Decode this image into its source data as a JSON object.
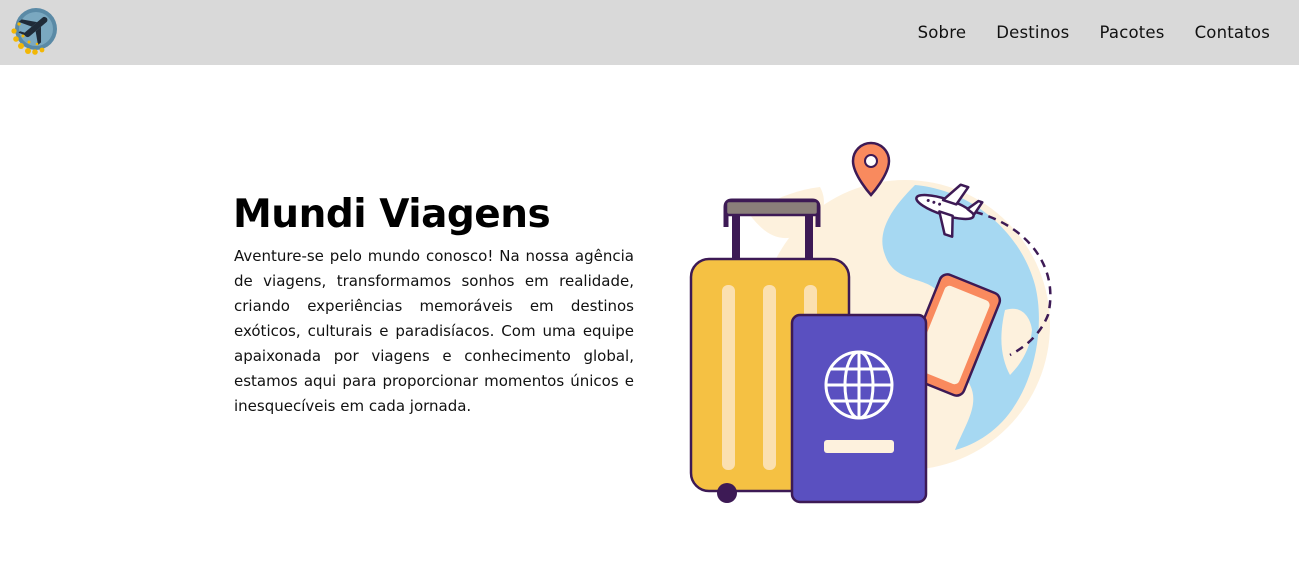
{
  "header": {
    "logo_icon": "airplane-logo-icon",
    "nav": [
      {
        "label": "Sobre"
      },
      {
        "label": "Destinos"
      },
      {
        "label": "Pacotes"
      },
      {
        "label": "Contatos"
      }
    ]
  },
  "hero": {
    "title": "Mundi Viagens",
    "description": "Aventure-se pelo mundo conosco! Na nossa agência de viagens, transformamos sonhos em realidade, criando experiências memoráveis em destinos exóticos, culturais e paradisíacos. Com uma equipe apaixonada por viagens e conhecimento global, estamos aqui para proporcionar momentos únicos e inesquecíveis em cada jornada.",
    "illustration": "travel-suitcase-passport-globe-illustration"
  },
  "colors": {
    "header_bg": "#d9d9d9",
    "suitcase": "#f5c143",
    "passport": "#5a50c0",
    "globe": "#a6d8f2",
    "pin": "#f98a5e",
    "outline": "#3d1a55"
  }
}
